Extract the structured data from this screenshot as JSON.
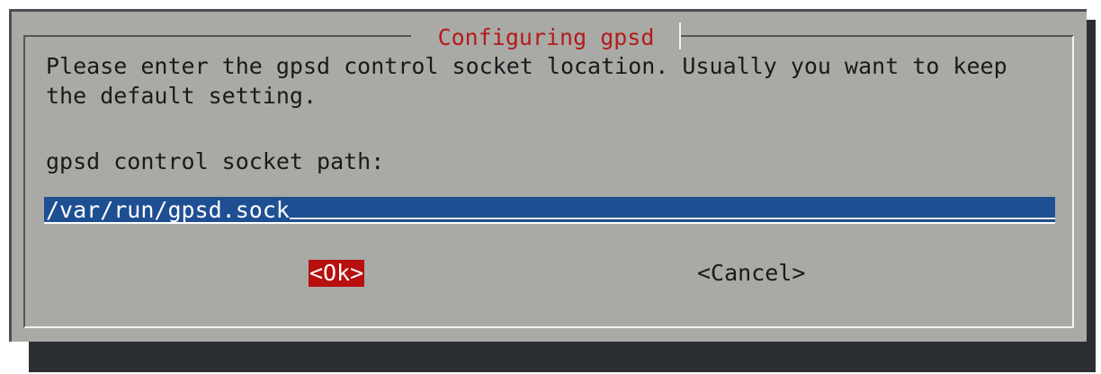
{
  "dialog": {
    "title": " Configuring gpsd ",
    "prompt": "Please enter the gpsd control socket location. Usually you want to keep\nthe default setting.",
    "field_label": "gpsd control socket path:",
    "input_value": "/var/run/gpsd.sock",
    "ok_label": "<Ok>",
    "cancel_label": "<Cancel>"
  },
  "colors": {
    "dialog_bg": "#a9aaa6",
    "title_text": "#b31b1b",
    "input_bg": "#1f4f93",
    "ok_highlight": "#b80f0f",
    "shadow": "#2b2e33"
  }
}
